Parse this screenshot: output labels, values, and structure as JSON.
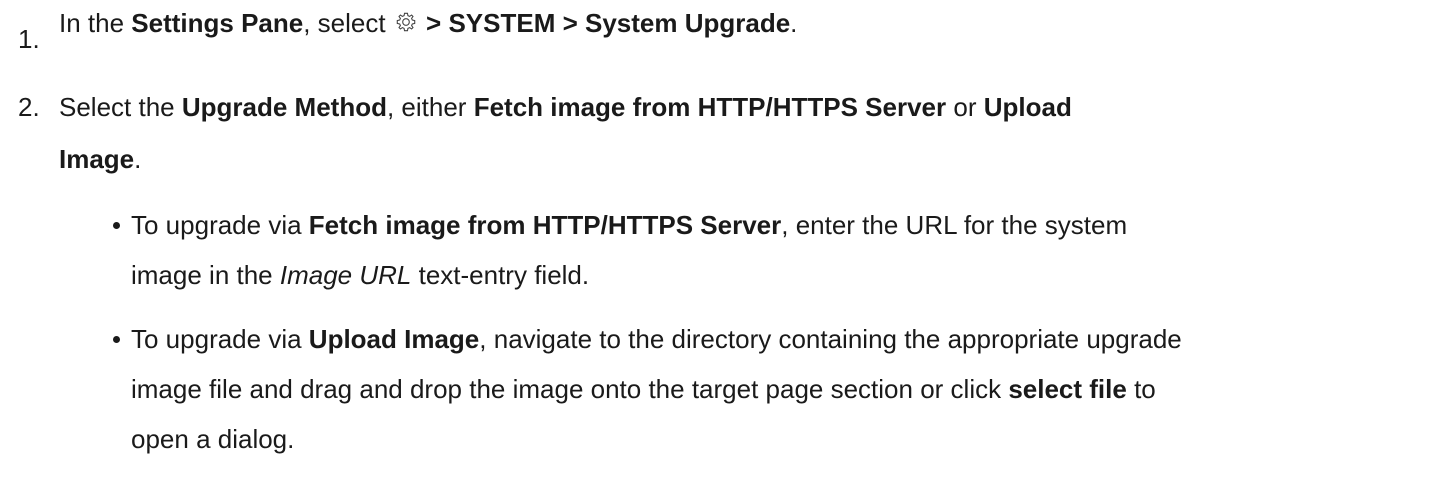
{
  "step1": {
    "number": "1.",
    "prefix": "In the ",
    "settings_pane": "Settings Pane",
    "select": ", select ",
    "path": " > SYSTEM > System Upgrade",
    "end": "."
  },
  "step2": {
    "number": "2.",
    "line1_prefix": "Select the ",
    "upgrade_method": "Upgrade Method",
    "either": ", either ",
    "fetch": "Fetch image from HTTP/HTTPS Server",
    "or": " or ",
    "upload_part1": "Upload",
    "upload_part2": "Image",
    "end": "."
  },
  "bullet1": {
    "prefix": "To upgrade via  ",
    "fetch": "Fetch image from HTTP/HTTPS Server",
    "mid": ", enter the URL for the system",
    "line2_prefix": "image in the ",
    "image_url": "Image URL",
    "line2_suffix": " text-entry field."
  },
  "bullet2": {
    "prefix": "To upgrade via ",
    "upload": "Upload Image",
    "line1_suffix": ", navigate to the directory containing the appropriate upgrade",
    "line2_prefix": "image file and drag and drop the image onto the target page section or click ",
    "select_file": "select file",
    "line2_suffix": " to",
    "line3": "open a dialog."
  },
  "icons": {
    "gear": "gear-icon"
  }
}
